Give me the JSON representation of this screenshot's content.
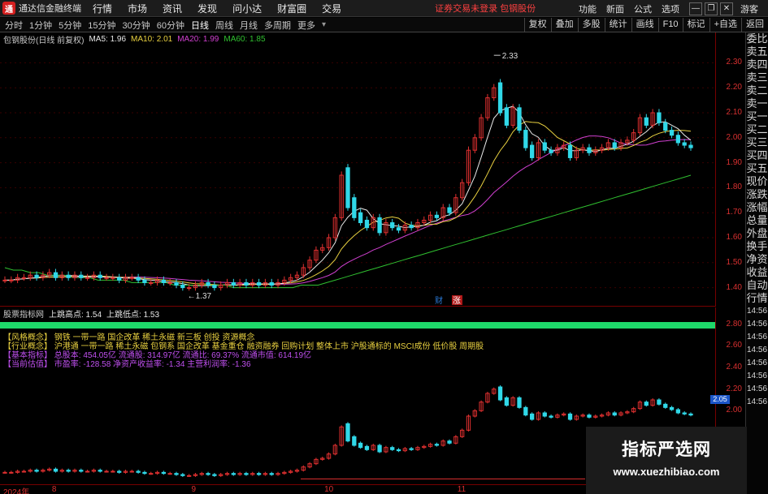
{
  "window": {
    "app_name": "通达信金融终端",
    "menu": [
      "行情",
      "市场",
      "资讯",
      "发现",
      "问小达",
      "财富圈",
      "交易"
    ],
    "status": "证券交易未登录  包钢股份",
    "right_menu": [
      "功能",
      "新面",
      "公式",
      "选项"
    ],
    "guest": "游客"
  },
  "toolbar": {
    "periods": [
      "分时",
      "1分钟",
      "5分钟",
      "15分钟",
      "30分钟",
      "60分钟",
      "日线",
      "周线",
      "月线",
      "多周期",
      "更多"
    ],
    "active": "日线",
    "right": [
      "复权",
      "叠加",
      "多股",
      "统计",
      "画线",
      "F10",
      "标记",
      "+自选",
      "返回"
    ]
  },
  "main_info": {
    "symbol": "包钢股份(日线 前复权)",
    "ma5": "MA5: 1.96",
    "ma10": "MA10: 2.01",
    "ma20": "MA20: 1.99",
    "ma60": "MA60: 1.85"
  },
  "right_sidebar": [
    "委比",
    "卖五",
    "卖四",
    "卖三",
    "卖二",
    "卖一",
    "买一",
    "买二",
    "买三",
    "买四",
    "买五",
    "现价",
    "涨跌",
    "涨幅",
    "总量",
    "外盘",
    "换手",
    "净资",
    "收益",
    "自动",
    "行情",
    "14:56",
    "14:56",
    "14:56",
    "14:56",
    "14:56",
    "14:56",
    "14:56",
    "14:56"
  ],
  "annotations": {
    "high": "2.33",
    "low": "1.37",
    "cai": "财",
    "zhang": "涨"
  },
  "sub_info": {
    "name": "股票指标网",
    "high": "上跳高点: 1.54",
    "low": "上跳低点: 1.53"
  },
  "text_lines": [
    {
      "label": "【风格概念】",
      "text": "钢铁 一带一路 国企改革 稀土永磁 新三板 创投 资源概念",
      "color": "#e8d040"
    },
    {
      "label": "【行业概念】",
      "text": "沪港通 一带一路 稀土永磁 包钢系 国企改革 基金重仓 融资融券 回购计划 整体上市 沪股通标的 MSCI成份 低价股 周期股",
      "color": "#e8d040"
    },
    {
      "label": "【基本指标】",
      "text": "总股本: 454.05亿  流通股: 314.97亿  流通比: 69.37%  流通市值: 614.19亿",
      "color": "#c050f0"
    },
    {
      "label": "【当前估值】",
      "text": "市盈率: -128.58  净资产收益率: -1.34  主营利润率: -1.36",
      "color": "#c050f0"
    }
  ],
  "colors": {
    "up": "#e03030",
    "down": "#30d8e8",
    "ma5": "#e8e8e8",
    "ma10": "#e8d040",
    "ma20": "#d040d0",
    "ma60": "#30c030"
  },
  "y_ticks_main": [
    "2.30",
    "2.20",
    "2.10",
    "2.00",
    "1.90",
    "1.80",
    "1.70",
    "1.60",
    "1.50",
    "1.40"
  ],
  "y_ticks_sub": [
    "2.80",
    "2.60",
    "2.40",
    "2.20",
    "2.05",
    "2.00"
  ],
  "current_price_badge": "2.05",
  "x_ticks": [
    {
      "label": "2024年",
      "frac": 0.0
    },
    {
      "label": "8",
      "frac": 0.068
    },
    {
      "label": "9",
      "frac": 0.263
    },
    {
      "label": "10",
      "frac": 0.449
    },
    {
      "label": "11",
      "frac": 0.635
    }
  ],
  "watermark": {
    "line1": "指标严选网",
    "line2": "www.xuezhibiao.com"
  },
  "chart_data": {
    "type": "candlestick",
    "ylim": [
      1.35,
      2.35
    ],
    "closes": [
      1.43,
      1.43,
      1.44,
      1.44,
      1.45,
      1.44,
      1.45,
      1.46,
      1.44,
      1.45,
      1.44,
      1.45,
      1.44,
      1.44,
      1.45,
      1.44,
      1.44,
      1.44,
      1.43,
      1.44,
      1.44,
      1.43,
      1.42,
      1.42,
      1.43,
      1.42,
      1.42,
      1.41,
      1.4,
      1.4,
      1.41,
      1.42,
      1.41,
      1.4,
      1.41,
      1.42,
      1.41,
      1.42,
      1.41,
      1.42,
      1.41,
      1.42,
      1.41,
      1.42,
      1.43,
      1.44,
      1.45,
      1.48,
      1.51,
      1.55,
      1.56,
      1.6,
      1.68,
      1.85,
      1.72,
      1.68,
      1.66,
      1.64,
      1.68,
      1.62,
      1.66,
      1.64,
      1.63,
      1.65,
      1.64,
      1.66,
      1.67,
      1.69,
      1.68,
      1.72,
      1.7,
      1.76,
      1.82,
      1.95,
      2.0,
      2.08,
      2.16,
      2.2,
      2.1,
      2.05,
      2.12,
      2.03,
      1.96,
      1.92,
      1.98,
      1.95,
      1.94,
      1.96,
      1.97,
      1.92,
      1.95,
      1.96,
      1.94,
      1.95,
      1.96,
      1.98,
      1.96,
      1.98,
      1.99,
      2.02,
      2.08,
      2.05,
      2.1,
      2.06,
      2.03,
      2.01,
      1.98,
      1.97,
      1.96
    ],
    "opens": [
      1.43,
      1.43,
      1.43,
      1.44,
      1.44,
      1.45,
      1.44,
      1.45,
      1.46,
      1.44,
      1.45,
      1.44,
      1.45,
      1.44,
      1.44,
      1.45,
      1.44,
      1.44,
      1.44,
      1.43,
      1.44,
      1.44,
      1.43,
      1.42,
      1.42,
      1.43,
      1.42,
      1.42,
      1.41,
      1.4,
      1.4,
      1.41,
      1.42,
      1.41,
      1.4,
      1.41,
      1.42,
      1.41,
      1.42,
      1.41,
      1.42,
      1.41,
      1.42,
      1.41,
      1.42,
      1.43,
      1.44,
      1.45,
      1.48,
      1.51,
      1.55,
      1.56,
      1.6,
      1.68,
      1.88,
      1.76,
      1.7,
      1.67,
      1.64,
      1.68,
      1.62,
      1.66,
      1.64,
      1.63,
      1.65,
      1.64,
      1.66,
      1.67,
      1.69,
      1.68,
      1.72,
      1.7,
      1.76,
      1.82,
      1.95,
      2.0,
      2.08,
      2.16,
      2.22,
      2.12,
      2.05,
      2.12,
      2.03,
      1.97,
      1.92,
      1.98,
      1.95,
      1.94,
      1.96,
      1.97,
      1.92,
      1.95,
      1.96,
      1.94,
      1.95,
      1.96,
      1.98,
      1.96,
      1.98,
      1.99,
      2.02,
      2.08,
      2.05,
      2.1,
      2.06,
      2.03,
      2.01,
      1.98,
      1.97
    ],
    "ma60": [
      1.48,
      1.47,
      1.47,
      1.46,
      1.46,
      1.45,
      1.45,
      1.45,
      1.44,
      1.44,
      1.44,
      1.43,
      1.43,
      1.43,
      1.43,
      1.42,
      1.42,
      1.42,
      1.42,
      1.42,
      1.41,
      1.41,
      1.41,
      1.41,
      1.41,
      1.41,
      1.41,
      1.4,
      1.4,
      1.4,
      1.4,
      1.4,
      1.4,
      1.4,
      1.4,
      1.41,
      1.41,
      1.41,
      1.42,
      1.43,
      1.44,
      1.45,
      1.46,
      1.47,
      1.48,
      1.49,
      1.5,
      1.51,
      1.52,
      1.53,
      1.54,
      1.55,
      1.56,
      1.57,
      1.58,
      1.59,
      1.6,
      1.61,
      1.62,
      1.63,
      1.64,
      1.65,
      1.66,
      1.67,
      1.68,
      1.69,
      1.7,
      1.71,
      1.72,
      1.73,
      1.74,
      1.75,
      1.76,
      1.77,
      1.78,
      1.79,
      1.8,
      1.81,
      1.82,
      1.83,
      1.84,
      1.85
    ]
  }
}
